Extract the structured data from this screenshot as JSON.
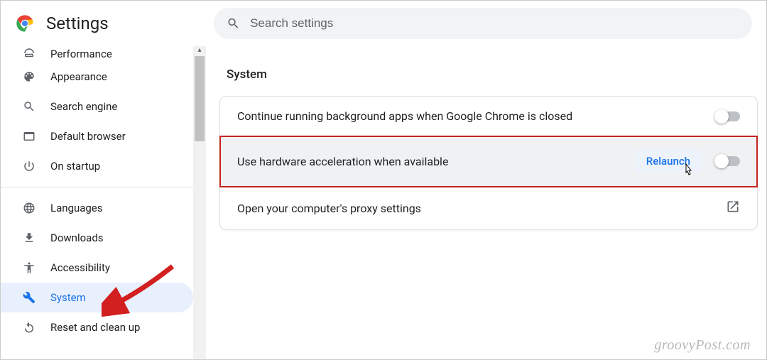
{
  "header": {
    "title": "Settings",
    "search_placeholder": "Search settings"
  },
  "sidebar": {
    "items": [
      {
        "label": "Performance",
        "icon": "speedometer-icon"
      },
      {
        "label": "Appearance",
        "icon": "palette-icon"
      },
      {
        "label": "Search engine",
        "icon": "search-icon"
      },
      {
        "label": "Default browser",
        "icon": "browser-icon"
      },
      {
        "label": "On startup",
        "icon": "power-icon"
      },
      {
        "label": "Languages",
        "icon": "globe-icon"
      },
      {
        "label": "Downloads",
        "icon": "download-icon"
      },
      {
        "label": "Accessibility",
        "icon": "accessibility-icon"
      },
      {
        "label": "System",
        "icon": "wrench-icon"
      },
      {
        "label": "Reset and clean up",
        "icon": "reset-icon"
      }
    ]
  },
  "content": {
    "section_title": "System",
    "rows": {
      "bg_apps": "Continue running background apps when Google Chrome is closed",
      "hw_accel": "Use hardware acceleration when available",
      "relaunch": "Relaunch",
      "proxy": "Open your computer's proxy settings"
    }
  },
  "watermark": "groovyPost.com"
}
